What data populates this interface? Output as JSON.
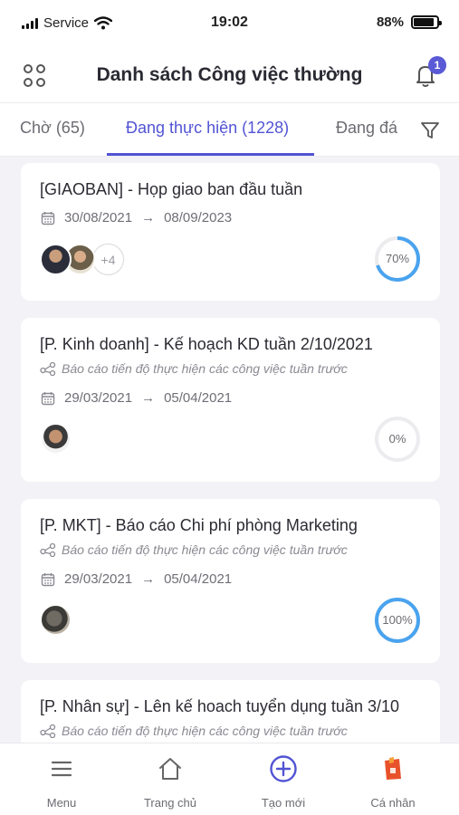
{
  "status_bar": {
    "carrier": "Service",
    "time": "19:02",
    "battery": "88%"
  },
  "header": {
    "title": "Danh sách Công việc thường",
    "notification_count": "1"
  },
  "tabs": [
    {
      "label": "Chờ (65)",
      "active": false
    },
    {
      "label": "Đang thực hiện (1228)",
      "active": true
    },
    {
      "label": "Đang đá",
      "active": false
    }
  ],
  "tasks": [
    {
      "title": "[GIAOBAN] - Họp giao ban đầu tuần",
      "description": "",
      "start_date": "30/08/2021",
      "end_date": "08/09/2023",
      "extra_assignees": "+4",
      "progress_label": "70%",
      "progress": 70
    },
    {
      "title": "[P. Kinh doanh] - Kế hoạch KD tuần 2/10/2021",
      "description": "Báo cáo tiến độ thực hiện các công việc tuần trước",
      "start_date": "29/03/2021",
      "end_date": "05/04/2021",
      "extra_assignees": "",
      "progress_label": "0%",
      "progress": 0
    },
    {
      "title": "[P. MKT] - Báo cáo Chi phí phòng Marketing",
      "description": "Báo cáo tiến độ thực hiện các công việc tuần trước",
      "start_date": "29/03/2021",
      "end_date": "05/04/2021",
      "extra_assignees": "",
      "progress_label": "100%",
      "progress": 100
    },
    {
      "title": "[P. Nhân sự] - Lên kế hoach tuyển dụng tuần 3/10",
      "description": "Báo cáo tiến độ thực hiện các công việc tuần trước",
      "start_date": "",
      "end_date": "",
      "extra_assignees": "",
      "progress_label": "",
      "progress": null
    }
  ],
  "bottom_nav": [
    {
      "label": "Menu",
      "icon": "hamburger-icon"
    },
    {
      "label": "Trang chủ",
      "icon": "home-icon"
    },
    {
      "label": "Tạo mới",
      "icon": "plus-circle-icon"
    },
    {
      "label": "Cá nhân",
      "icon": "personal-icon"
    }
  ],
  "colors": {
    "accent": "#5254d4",
    "progress": "#4aa3ee",
    "track": "#ececef",
    "personal_icon": "#e8522b"
  }
}
